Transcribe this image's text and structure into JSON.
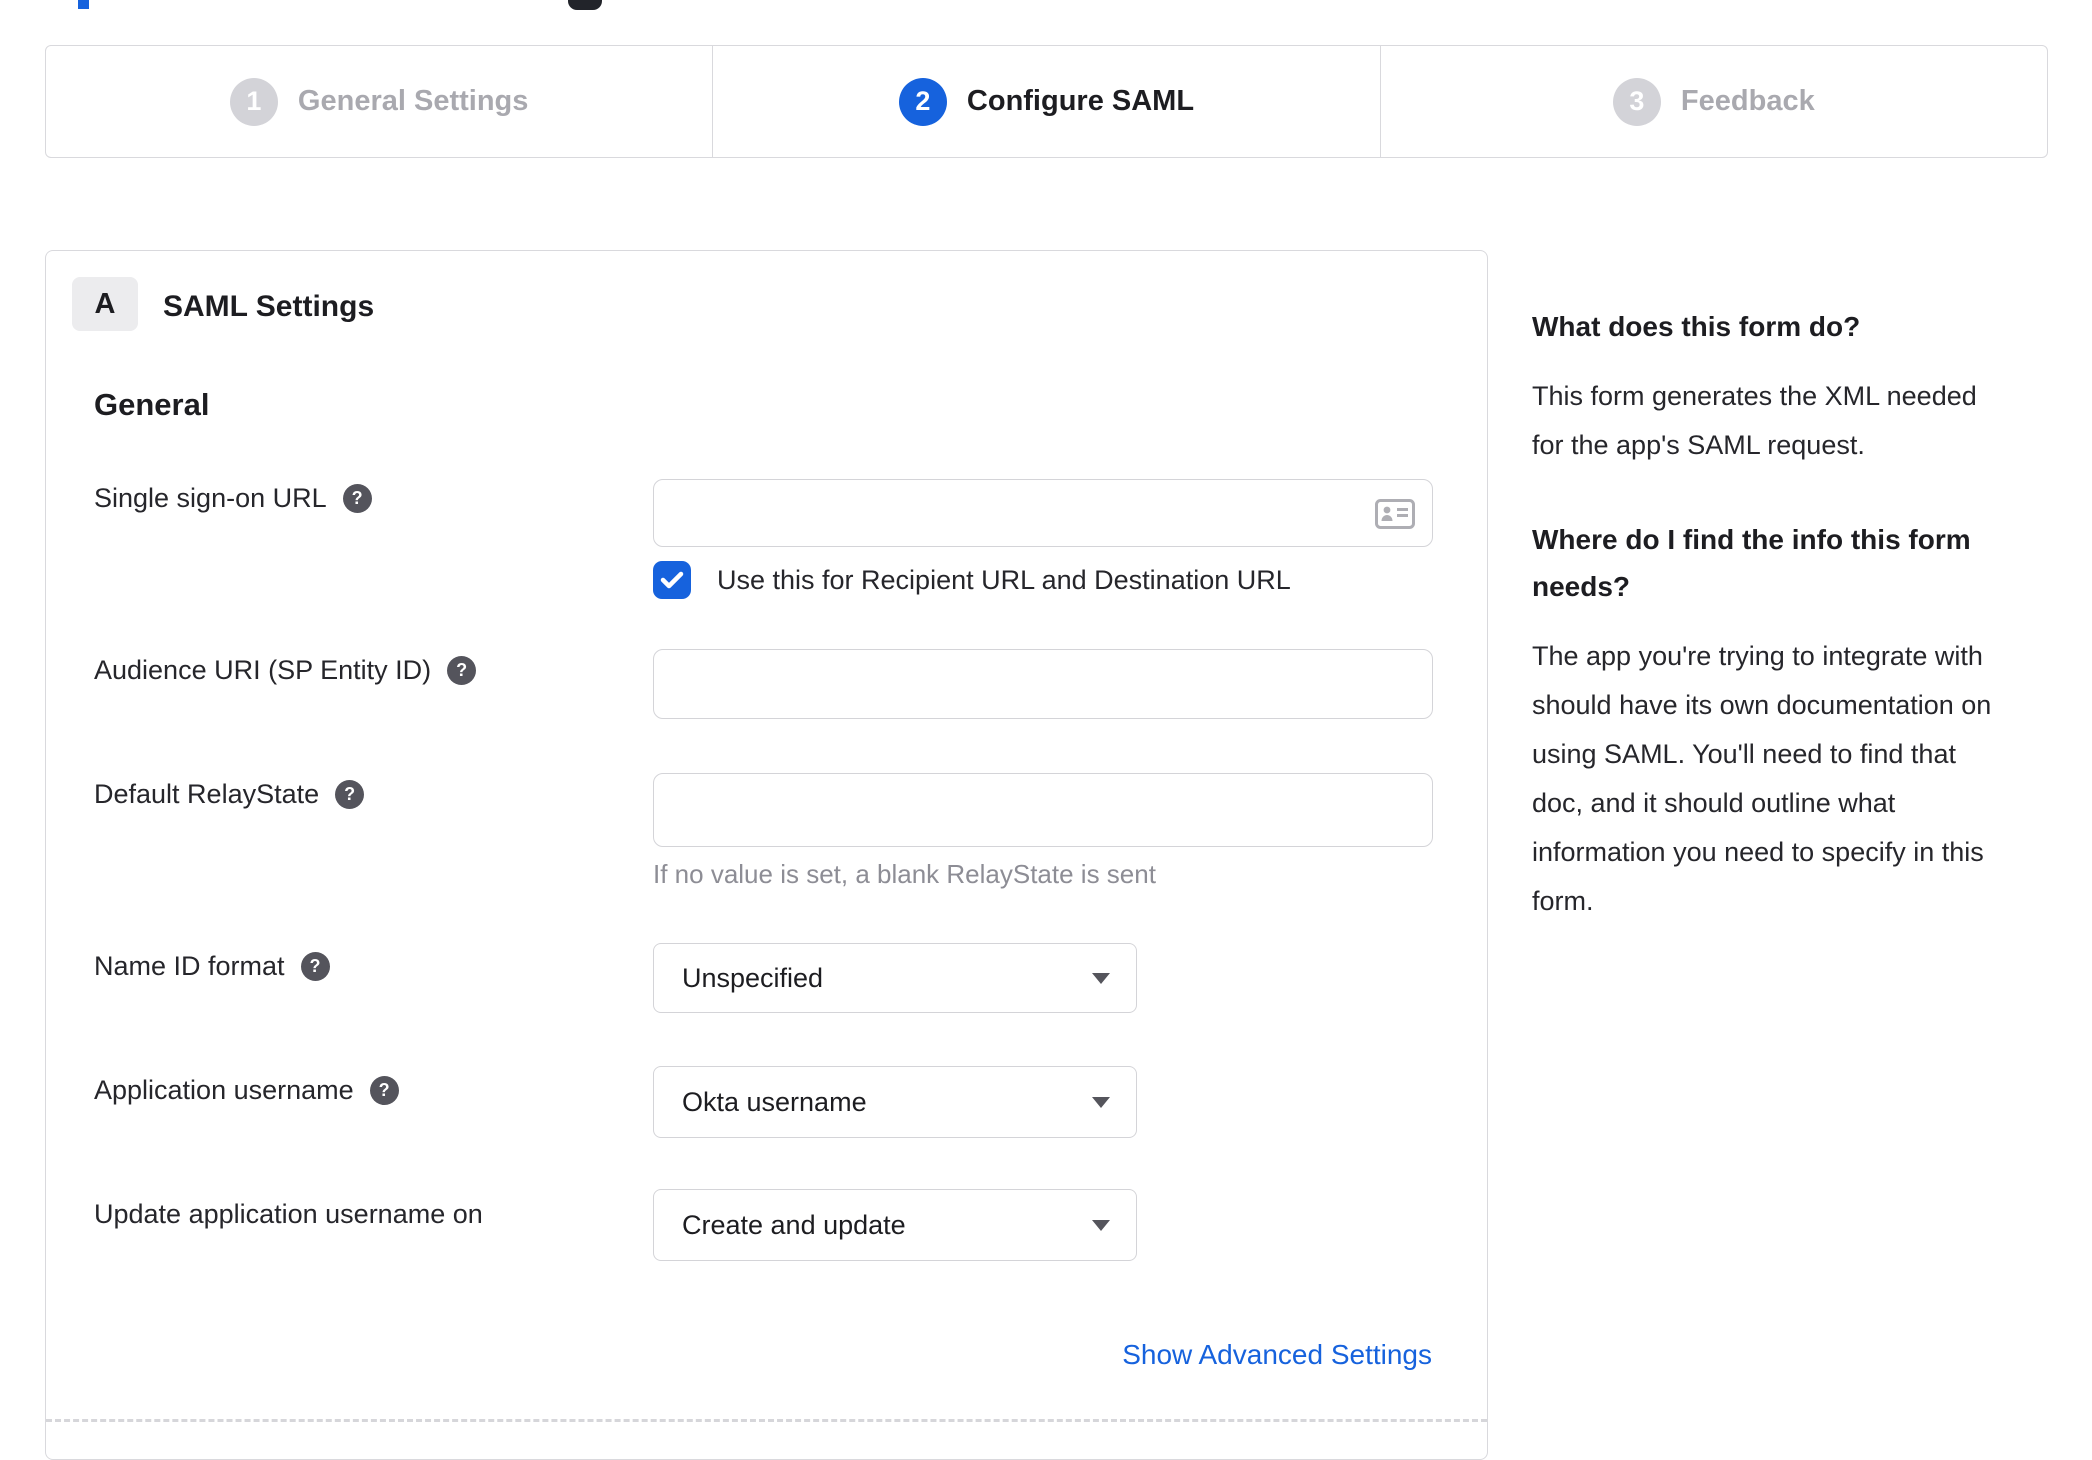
{
  "stepper": {
    "steps": [
      {
        "number": "1",
        "label": "General Settings"
      },
      {
        "number": "2",
        "label": "Configure SAML"
      },
      {
        "number": "3",
        "label": "Feedback"
      }
    ]
  },
  "panel": {
    "badge": "A",
    "title": "SAML Settings",
    "section_heading": "General",
    "fields": {
      "sso_url": {
        "label": "Single sign-on URL",
        "value": "",
        "checkbox_label": "Use this for Recipient URL and Destination URL",
        "checkbox_checked": "true"
      },
      "audience_uri": {
        "label": "Audience URI (SP Entity ID)",
        "value": ""
      },
      "default_relay_state": {
        "label": "Default RelayState",
        "value": "",
        "hint": "If no value is set, a blank RelayState is sent"
      },
      "name_id_format": {
        "label": "Name ID format",
        "value": "Unspecified"
      },
      "application_username": {
        "label": "Application username",
        "value": "Okta username"
      },
      "update_application_username_on": {
        "label": "Update application username on",
        "value": "Create and update"
      }
    },
    "advanced_link": "Show Advanced Settings"
  },
  "help_sidebar": {
    "q1_heading": "What does this form do?",
    "q1_body": "This form generates the XML needed\nfor the app's SAML request.",
    "q2_heading": "Where do I find the info this form\nneeds?",
    "q2_body": "The app you're trying to integrate with\nshould have its own documentation on\nusing SAML. You'll need to find that\ndoc, and it should outline what\ninformation you need to specify in this\nform."
  },
  "colors": {
    "accent_blue": "#1662dd",
    "inactive_gray": "#d3d3d8",
    "border_gray": "#d9d9dd"
  }
}
